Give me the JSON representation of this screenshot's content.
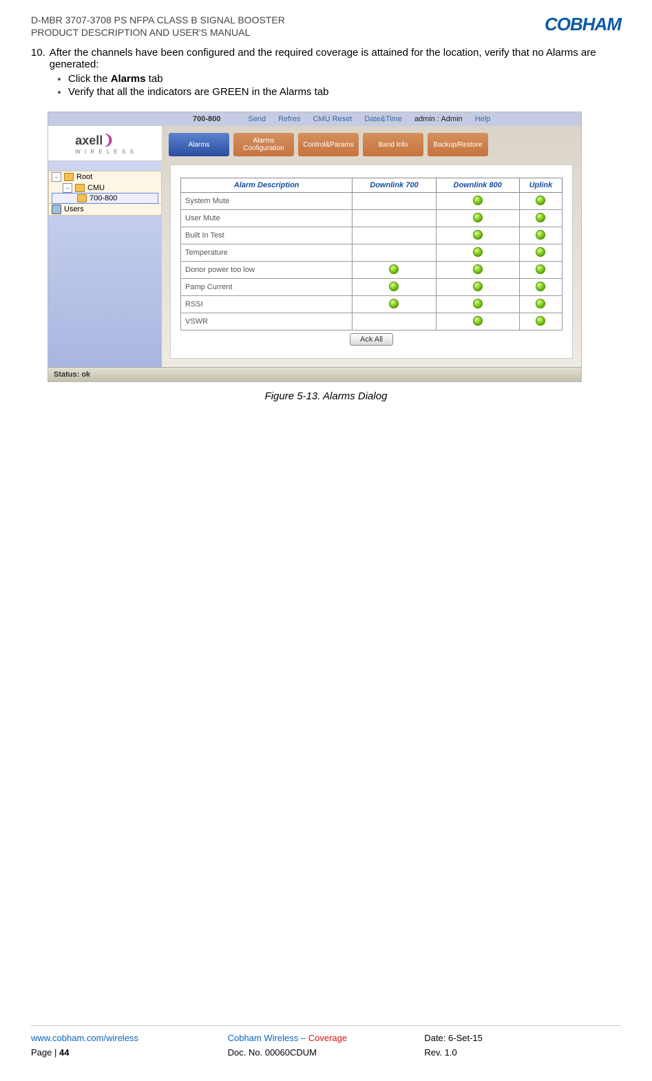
{
  "header": {
    "line1": "D-MBR 3707-3708 PS NFPA CLASS B SIGNAL BOOSTER",
    "line2": "PRODUCT DESCRIPTION AND USER'S MANUAL",
    "brand": "COBHAM"
  },
  "step": {
    "number": "10.",
    "text": "After the channels have been configured and the required coverage is attained for the location, verify that no Alarms are generated:"
  },
  "bullets": {
    "b1_pre": "Click the ",
    "b1_bold": "Alarms",
    "b1_post": " tab",
    "b2": "Verify that all the indicators are GREEN in the Alarms tab"
  },
  "topbar": {
    "title": "700-800",
    "links": [
      "Send",
      "Refres",
      "CMU Reset",
      "Date&Time"
    ],
    "user": "admin : Admin",
    "help": "Help"
  },
  "tree": {
    "root": "Root",
    "cmu": "CMU",
    "node": "700-800",
    "users": "Users"
  },
  "tabs": [
    "Alarms",
    "Alarms Configuration",
    "Control&Params",
    "Band Info",
    "Backup/Restore"
  ],
  "table": {
    "headers": [
      "Alarm Description",
      "Downlink 700",
      "Downlink 800",
      "Uplink"
    ],
    "rows": [
      {
        "name": "System Mute",
        "d7": false,
        "d8": true,
        "ul": true
      },
      {
        "name": "User Mute",
        "d7": false,
        "d8": true,
        "ul": true
      },
      {
        "name": "Built In Test",
        "d7": false,
        "d8": true,
        "ul": true
      },
      {
        "name": "Temperature",
        "d7": false,
        "d8": true,
        "ul": true
      },
      {
        "name": "Donor power too low",
        "d7": true,
        "d8": true,
        "ul": true
      },
      {
        "name": "Pamp Current",
        "d7": true,
        "d8": true,
        "ul": true
      },
      {
        "name": "RSSI",
        "d7": true,
        "d8": true,
        "ul": true
      },
      {
        "name": "VSWR",
        "d7": false,
        "d8": true,
        "ul": true
      }
    ],
    "ack": "Ack All"
  },
  "statusbar": "Status: ok",
  "caption": "Figure 5-13. Alarms Dialog",
  "footer": {
    "url": "www.cobham.com/wireless",
    "page_label": "Page | ",
    "page_num": "44",
    "mid1a": "Cobham Wireless",
    "mid1b": " – ",
    "mid1c": "Coverage",
    "mid2": "Doc. No. 00060CDUM",
    "date": "Date: 6-Set-15",
    "rev": "Rev. 1.0"
  }
}
